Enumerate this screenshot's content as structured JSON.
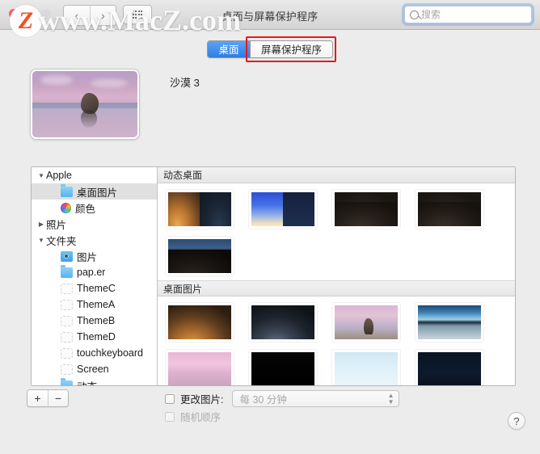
{
  "window": {
    "title": "桌面与屏幕保护程序"
  },
  "watermark": {
    "logo_letter": "Z",
    "text": "www.MacZ.com"
  },
  "toolbar": {
    "back_label": "‹",
    "forward_label": "›",
    "grid_label": "grid-icon",
    "search_placeholder": "搜索",
    "search_value": ""
  },
  "tabs": [
    {
      "label": "桌面",
      "active": true
    },
    {
      "label": "屏幕保护程序",
      "active": false,
      "highlighted": true
    }
  ],
  "preview": {
    "label": "沙漠 3"
  },
  "sidebar": {
    "items": [
      {
        "label": "Apple",
        "type": "group",
        "twisty": "▼",
        "indent": 0,
        "icon": "none",
        "selected": false
      },
      {
        "label": "桌面图片",
        "type": "item",
        "twisty": "",
        "indent": 1,
        "icon": "folder",
        "selected": true
      },
      {
        "label": "颜色",
        "type": "item",
        "twisty": "",
        "indent": 1,
        "icon": "color",
        "selected": false
      },
      {
        "label": "照片",
        "type": "group",
        "twisty": "▶",
        "indent": 0,
        "icon": "none",
        "selected": false
      },
      {
        "label": "文件夹",
        "type": "group",
        "twisty": "▼",
        "indent": 0,
        "icon": "none",
        "selected": false
      },
      {
        "label": "图片",
        "type": "item",
        "twisty": "",
        "indent": 1,
        "icon": "photos",
        "selected": false
      },
      {
        "label": "pap.er",
        "type": "item",
        "twisty": "",
        "indent": 1,
        "icon": "folder",
        "selected": false
      },
      {
        "label": "ThemeC",
        "type": "item",
        "twisty": "",
        "indent": 1,
        "icon": "empty",
        "selected": false
      },
      {
        "label": "ThemeA",
        "type": "item",
        "twisty": "",
        "indent": 1,
        "icon": "empty",
        "selected": false
      },
      {
        "label": "ThemeB",
        "type": "item",
        "twisty": "",
        "indent": 1,
        "icon": "empty",
        "selected": false
      },
      {
        "label": "ThemeD",
        "type": "item",
        "twisty": "",
        "indent": 1,
        "icon": "empty",
        "selected": false
      },
      {
        "label": "touchkeyboard",
        "type": "item",
        "twisty": "",
        "indent": 1,
        "icon": "empty",
        "selected": false
      },
      {
        "label": "Screen",
        "type": "item",
        "twisty": "",
        "indent": 1,
        "icon": "empty",
        "selected": false
      },
      {
        "label": "动态",
        "type": "item",
        "twisty": "",
        "indent": 1,
        "icon": "folder",
        "selected": false
      }
    ]
  },
  "gallery": {
    "sections": [
      {
        "title": "动态桌面",
        "thumbs": [
          {
            "name": "mojave-dynamic",
            "art": "split-mojave"
          },
          {
            "name": "solar-gradients",
            "art": "split-solar"
          },
          {
            "name": "mojave-dunes-dusk",
            "art": "w-dune-dusk"
          },
          {
            "name": "mojave-dunes-dusk-2",
            "art": "w-dune-dusk"
          },
          {
            "name": "mojave-dunes-night",
            "art": "w-dune-night"
          }
        ]
      },
      {
        "title": "桌面图片",
        "thumbs": [
          {
            "name": "mojave-day",
            "art": "w-mojave-dunes-day"
          },
          {
            "name": "mojave-night",
            "art": "w-mojave-dunes-night"
          },
          {
            "name": "desert-rock",
            "art": "w-rock-pink"
          },
          {
            "name": "salt-flat",
            "art": "w-saltflat"
          },
          {
            "name": "pink-flat",
            "art": "w-pinkflat"
          },
          {
            "name": "solid-black",
            "art": "w-black"
          },
          {
            "name": "light-blue-sky",
            "art": "w-lightblue"
          },
          {
            "name": "dark-navy",
            "art": "w-darknavy"
          }
        ]
      }
    ]
  },
  "bottom": {
    "add_label": "+",
    "remove_label": "−",
    "change_picture_label": "更改图片:",
    "change_picture_checked": false,
    "interval_value": "每 30 分钟",
    "random_order_label": "随机顺序",
    "random_order_enabled": false,
    "help_label": "?"
  },
  "colors": {
    "accent_blue": "#2d7de3",
    "highlight_red": "#e11b1b",
    "window_bg": "#ececec"
  }
}
